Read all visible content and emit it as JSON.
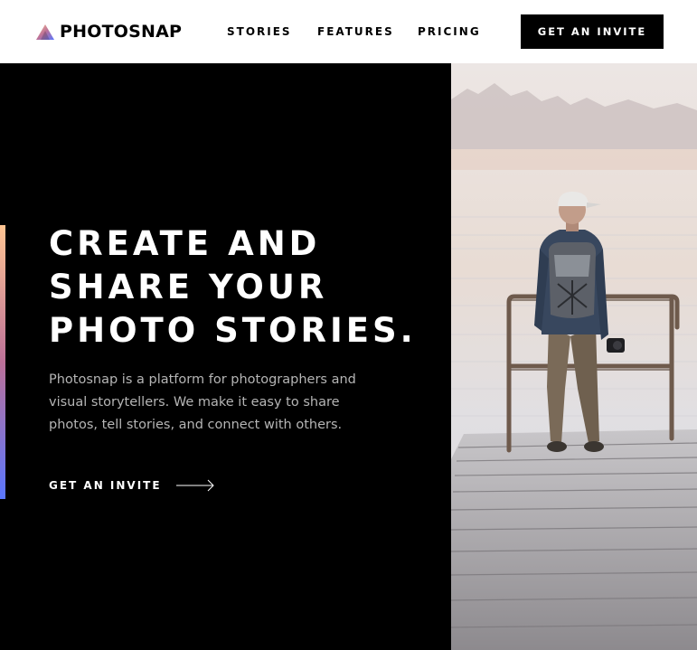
{
  "brand": {
    "name": "PHOTOSNAP",
    "gradient": [
      "#ffc593",
      "#bc7198",
      "#5a77ff"
    ]
  },
  "nav": {
    "items": [
      {
        "label": "STORIES"
      },
      {
        "label": "FEATURES"
      },
      {
        "label": "PRICING"
      }
    ],
    "cta_label": "GET AN INVITE"
  },
  "hero": {
    "title_lines": [
      "CREATE AND",
      "SHARE YOUR",
      "PHOTO STORIES."
    ],
    "description": "Photosnap is a platform for photographers and visual storytellers. We make it easy to share photos, tell stories, and connect with others.",
    "cta_label": "GET AN INVITE",
    "cta_icon": "arrow-right-icon",
    "image_subject": "hiker-on-pier-photo"
  },
  "colors": {
    "background_dark": "#000000",
    "text_light": "#ffffff",
    "text_muted": "#b5b5b5"
  }
}
